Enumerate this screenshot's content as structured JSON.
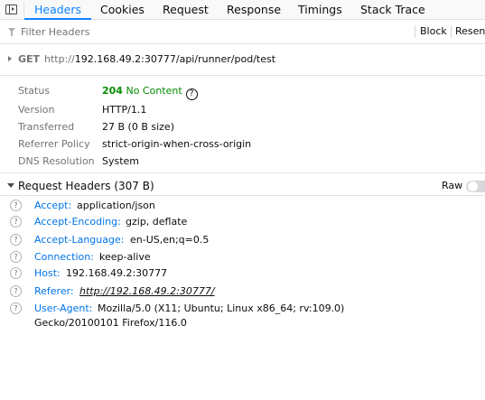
{
  "tabs": [
    {
      "label": "Headers",
      "active": true
    },
    {
      "label": "Cookies",
      "active": false
    },
    {
      "label": "Request",
      "active": false
    },
    {
      "label": "Response",
      "active": false
    },
    {
      "label": "Timings",
      "active": false
    },
    {
      "label": "Stack Trace",
      "active": false
    }
  ],
  "filter": {
    "placeholder": "Filter Headers",
    "block_label": "Block",
    "resend_label": "Resen"
  },
  "request_line": {
    "method": "GET",
    "url_host": "http://",
    "url_rest": "192.168.49.2:30777/api/runner/pod/test"
  },
  "summary": {
    "status": {
      "label": "Status",
      "code": "204",
      "text": "No Content",
      "help": "?"
    },
    "version": {
      "label": "Version",
      "value": "HTTP/1.1"
    },
    "transferred": {
      "label": "Transferred",
      "value": "27 B (0 B size)"
    },
    "referrer_policy": {
      "label": "Referrer Policy",
      "value": "strict-origin-when-cross-origin"
    },
    "dns_resolution": {
      "label": "DNS Resolution",
      "value": "System"
    }
  },
  "request_headers": {
    "title": "Request Headers (307 B)",
    "raw_label": "Raw",
    "raw_enabled": false,
    "items": [
      {
        "name": "Accept:",
        "value": "application/json"
      },
      {
        "name": "Accept-Encoding:",
        "value": "gzip, deflate"
      },
      {
        "name": "Accept-Language:",
        "value": "en-US,en;q=0.5"
      },
      {
        "name": "Connection:",
        "value": "keep-alive"
      },
      {
        "name": "Host:",
        "value": "192.168.49.2:30777"
      },
      {
        "name": "Referer:",
        "value": "http://192.168.49.2:30777/"
      },
      {
        "name": "User-Agent:",
        "value": "Mozilla/5.0 (X11; Ubuntu; Linux x86_64; rv:109.0) Gecko/20100101 Firefox/116.0"
      }
    ]
  },
  "colors": {
    "accent": "#0a84ff",
    "header_name": "#0074e8",
    "status_ok": "#058b00"
  }
}
